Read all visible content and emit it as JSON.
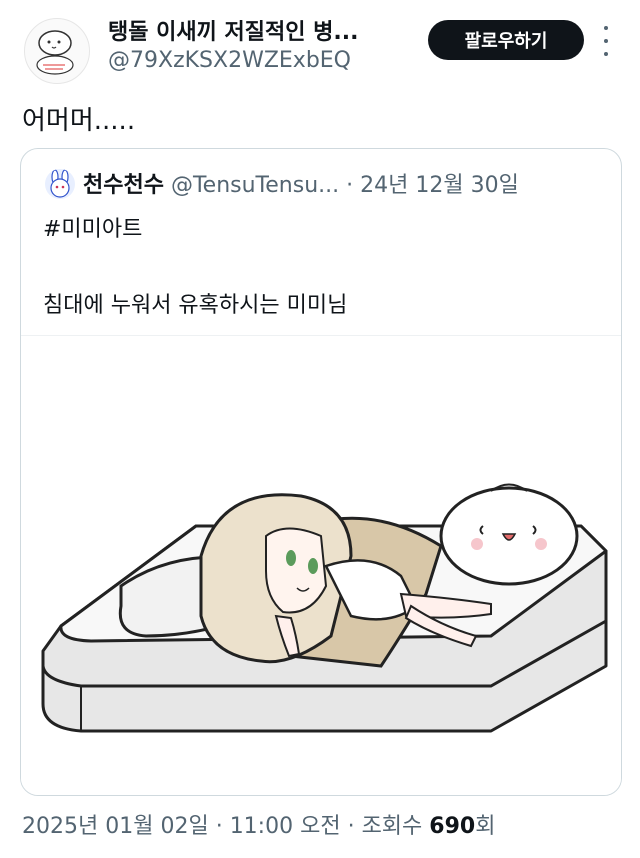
{
  "author": {
    "display_name": "탱돌 이새끼 저질적인 병...",
    "handle": "@79XzKSX2WZExbEQ",
    "avatar_icon": "doodle-avatar-icon"
  },
  "follow_button_label": "팔로우하기",
  "more_icon": "more-vertical-icon",
  "tweet_text": "어머머.....",
  "quoted": {
    "display_name": "천수천수",
    "handle": "@TensuTensu...",
    "separator": "·",
    "date": "24년 12월 30일",
    "hashtag": "#미미아트",
    "body": "침대에 누워서 유혹하시는 미미님",
    "avatar_icon": "bunny-avatar-icon",
    "media_icon": "illustration-girl-on-bed"
  },
  "meta": {
    "date": "2025년 01월 02일",
    "sep1": "·",
    "time": "11:00 오전",
    "sep2": "·",
    "views_label": "조회수",
    "views_count": "690",
    "views_suffix": "회"
  },
  "colors": {
    "text": "#0f1419",
    "secondary": "#536471",
    "border": "#cfd9de",
    "button_bg": "#0f1419"
  }
}
